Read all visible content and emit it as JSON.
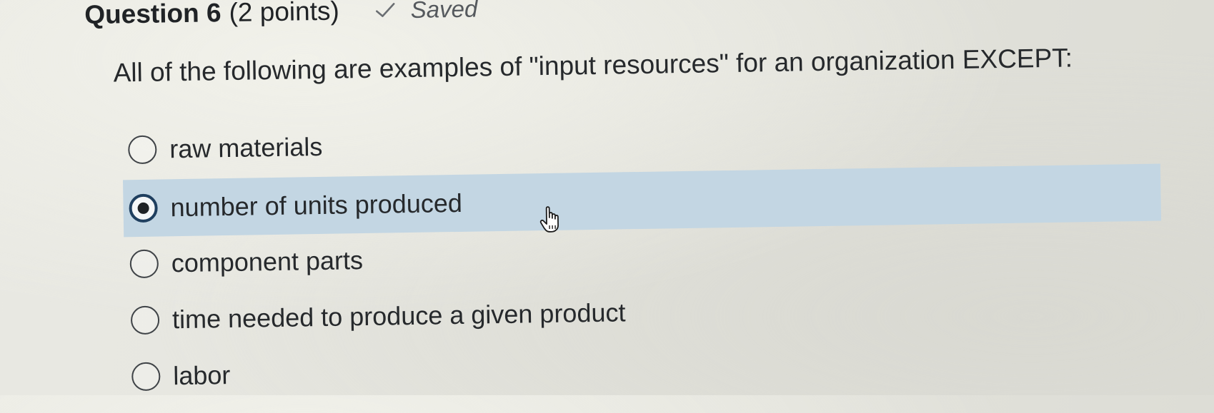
{
  "header": {
    "title": "Question 6",
    "points": "(2 points)",
    "status_icon": "check-icon",
    "status_text": "Saved"
  },
  "question": {
    "text": "All of the following are examples of \"input resources\" for an organization EXCEPT:"
  },
  "options": [
    {
      "label": "raw materials",
      "selected": false
    },
    {
      "label": "number of units produced",
      "selected": true
    },
    {
      "label": "component parts",
      "selected": false
    },
    {
      "label": "time needed to produce a given product",
      "selected": false
    },
    {
      "label": "labor",
      "selected": false
    }
  ],
  "colors": {
    "selected_row": "#c3d6e3",
    "radio_selected_ring": "#1f3f5f",
    "text": "#26292c"
  },
  "cursor": {
    "icon": "hand-pointer-icon"
  }
}
